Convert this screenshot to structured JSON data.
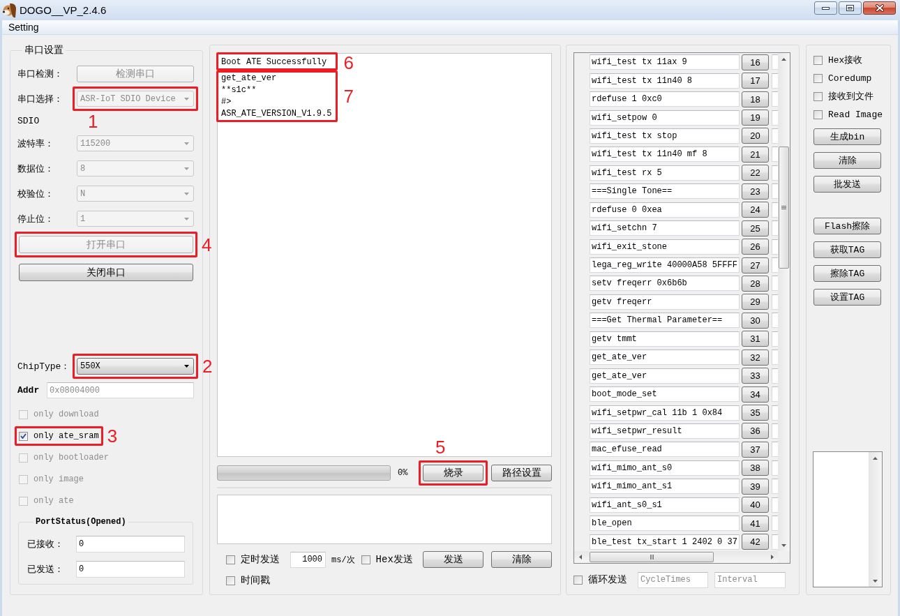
{
  "window": {
    "title": "DOGO__VP_2.4.6"
  },
  "menu_bar": [
    {
      "label": "Setting"
    }
  ],
  "serial_settings": {
    "title": "串口设置",
    "rows": [
      {
        "kind": "button",
        "label": "串口检测：",
        "value": "检测串口",
        "disabled": true
      },
      {
        "kind": "select",
        "label": "串口选择：",
        "value": "ASR-IoT SDIO Device",
        "disabled": true,
        "annotation": "1"
      },
      {
        "kind": "text",
        "label": "SDIO"
      },
      {
        "kind": "select",
        "label": "波特率：",
        "value": "115200",
        "disabled": true
      },
      {
        "kind": "select",
        "label": "数据位：",
        "value": "8",
        "disabled": true
      },
      {
        "kind": "select",
        "label": "校验位：",
        "value": "N",
        "disabled": true
      },
      {
        "kind": "select",
        "label": "停止位：",
        "value": "1",
        "disabled": true
      }
    ],
    "port_buttons": [
      {
        "label": "打开串口",
        "disabled": true,
        "annotation": "4"
      },
      {
        "label": "关闭串口",
        "disabled": false
      }
    ],
    "chip_type": {
      "label": "ChipType：",
      "value": "550X",
      "disabled": false,
      "annotation": "2"
    },
    "addr": {
      "label": "Addr",
      "placeholder": "0x08004000"
    },
    "options": [
      {
        "label": "only download",
        "checked": false,
        "disabled": true
      },
      {
        "label": "only ate_sram",
        "checked": true,
        "disabled": false,
        "annotation": "3"
      },
      {
        "label": "only bootloader",
        "checked": false,
        "disabled": true
      },
      {
        "label": "only image",
        "checked": false,
        "disabled": true
      },
      {
        "label": "only ate",
        "checked": false,
        "disabled": true
      }
    ],
    "port_status": {
      "title": "PortStatus(Opened)",
      "counters": [
        {
          "label": "已接收：",
          "value": "0"
        },
        {
          "label": "已发送：",
          "value": "0"
        }
      ]
    }
  },
  "output": {
    "log": [
      {
        "lines": [
          "Boot ATE Successfully"
        ],
        "annotation": "6"
      },
      {
        "lines": [
          "get_ate_ver",
          "**s1c**",
          "#>",
          "ASR_ATE_VERSION_V1.9.5"
        ],
        "annotation": "7"
      }
    ],
    "progress": {
      "level": 0,
      "reading": "0%"
    },
    "buttons": [
      {
        "label": "烧录",
        "annotation": "5"
      },
      {
        "label": "路径设置"
      }
    ]
  },
  "send": {
    "timed_send": {
      "label": "定时发送",
      "checked": false
    },
    "period": {
      "value": "1000"
    },
    "period_unit": "ms/次",
    "hex_send": {
      "label": "Hex发送",
      "checked": false
    },
    "buttons": [
      {
        "label": "发送"
      },
      {
        "label": "清除"
      }
    ],
    "timestamp": {
      "label": "时间戳",
      "checked": false
    }
  },
  "command_list": {
    "rows": [
      {
        "command": "wifi_test tx 11ax 9",
        "number": "16"
      },
      {
        "command": "wifi_test tx 11n40 8",
        "number": "17"
      },
      {
        "command": "rdefuse 1 0xc0",
        "number": "18"
      },
      {
        "command": "wifi_setpow 0",
        "number": "19"
      },
      {
        "command": "wifi_test tx stop",
        "number": "20"
      },
      {
        "command": "wifi_test tx 11n40 mf 8",
        "number": "21"
      },
      {
        "command": "wifi_test rx 5",
        "number": "22"
      },
      {
        "command": "===Single Tone==",
        "number": "23"
      },
      {
        "command": "rdefuse 0 0xea",
        "number": "24"
      },
      {
        "command": "wifi_setchn 7",
        "number": "25"
      },
      {
        "command": "wifi_exit_stone",
        "number": "26"
      },
      {
        "command": "lega_reg_write 40000A58 5FFFF",
        "number": "27"
      },
      {
        "command": "setv freqerr 0x6b6b",
        "number": "28"
      },
      {
        "command": "getv freqerr",
        "number": "29"
      },
      {
        "command": "===Get Thermal Parameter==",
        "number": "30"
      },
      {
        "command": "getv tmmt",
        "number": "31"
      },
      {
        "command": "get_ate_ver",
        "number": "32"
      },
      {
        "command": "get_ate_ver",
        "number": "33"
      },
      {
        "command": "boot_mode_set",
        "number": "34"
      },
      {
        "command": "wifi_setpwr_cal 11b 1 0x84",
        "number": "35"
      },
      {
        "command": "wifi_setpwr_result",
        "number": "36"
      },
      {
        "command": "mac_efuse_read",
        "number": "37"
      },
      {
        "command": "wifi_mimo_ant_s0",
        "number": "38"
      },
      {
        "command": "wifi_mimo_ant_s1",
        "number": "39"
      },
      {
        "command": "wifi_ant_s0_s1",
        "number": "40"
      },
      {
        "command": "ble_open",
        "number": "41"
      },
      {
        "command": "ble_test tx_start 1 2402 0 37",
        "number": "42"
      }
    ],
    "loop_send": {
      "label": "循环发送",
      "checked": false
    },
    "cycle_times": {
      "placeholder": "CycleTimes"
    },
    "interval": {
      "placeholder": "Interval"
    }
  },
  "tools": {
    "receive_options": [
      {
        "label": "Hex接收",
        "checked": false
      },
      {
        "label": "Coredump",
        "checked": false
      },
      {
        "label": "接收到文件",
        "checked": false
      },
      {
        "label": "Read Image",
        "checked": false
      }
    ],
    "button_groups": [
      [
        {
          "label": "生成bin"
        },
        {
          "label": "清除"
        },
        {
          "label": "批发送"
        }
      ],
      [
        {
          "label": "Flash擦除"
        },
        {
          "label": "获取TAG"
        },
        {
          "label": "擦除TAG"
        },
        {
          "label": "设置TAG"
        }
      ]
    ]
  }
}
